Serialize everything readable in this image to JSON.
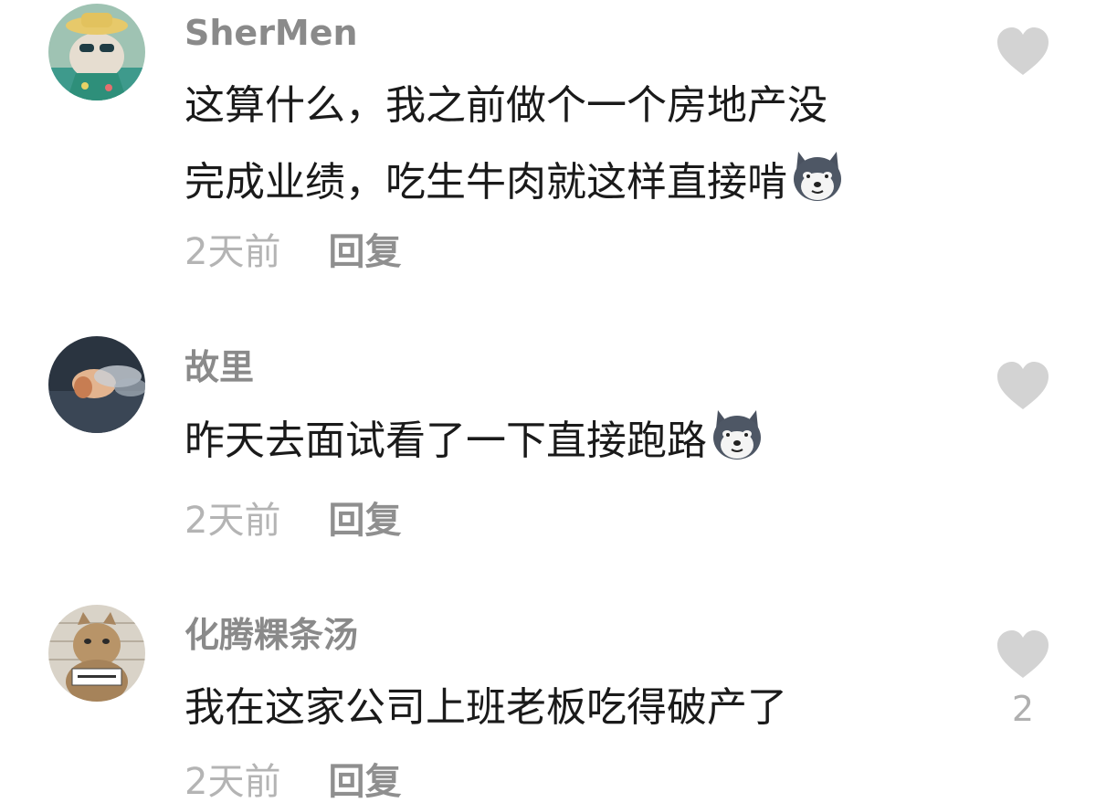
{
  "comments": [
    {
      "username": "SherMen",
      "line1": "这算什么，我之前做个一个房地产没",
      "line2": "完成业绩，吃生牛肉就这样直接啃",
      "emoji": "husky-emoji",
      "time": "2天前",
      "reply": "回复",
      "avatar": "cat-sunglasses-avatar"
    },
    {
      "username": "故里",
      "line1": "昨天去面试看了一下直接跑路",
      "emoji": "husky-emoji",
      "time": "2天前",
      "reply": "回复",
      "avatar": "smoke-portrait-avatar"
    },
    {
      "username": "化腾粿条汤",
      "line1": "我在这家公司上班老板吃得破产了",
      "like_count": "2",
      "time": "2天前",
      "reply": "回复",
      "avatar": "cat-mugshot-avatar"
    }
  ],
  "icons": {
    "like": "heart-icon"
  },
  "colors": {
    "username": "#8a8a8a",
    "text": "#1a1a1a",
    "meta": "#b4b4b4",
    "heart": "#d3d3d3"
  }
}
